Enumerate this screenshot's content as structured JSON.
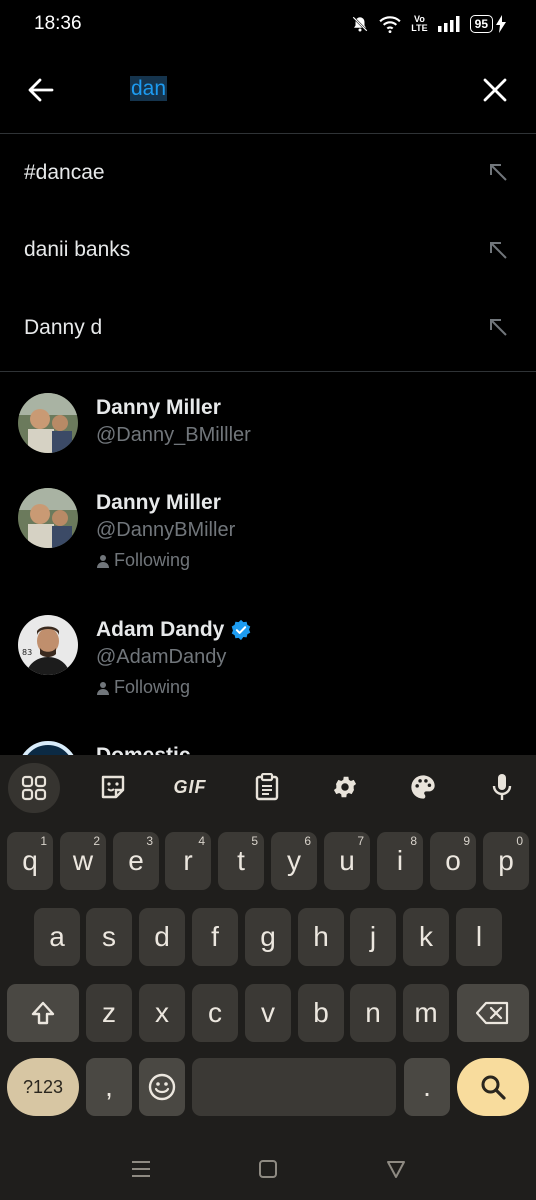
{
  "status": {
    "time": "18:36",
    "network": "Vo\nLTE",
    "battery": "95"
  },
  "search": {
    "query": "dan"
  },
  "suggestions": [
    {
      "prefix": "#dan",
      "rest": "cae"
    },
    {
      "prefix": "dan",
      "rest": "ii banks"
    },
    {
      "prefix": "Dan",
      "rest": "ny d"
    }
  ],
  "users": [
    {
      "name": "Danny Miller",
      "handle": "@Danny_BMilller",
      "following": "",
      "verified": false
    },
    {
      "name": "Danny Miller",
      "handle": "@DannyBMiller",
      "following": "Following",
      "verified": false
    },
    {
      "name": "Adam Dandy",
      "handle": "@AdamDandy",
      "following": "Following",
      "verified": true
    },
    {
      "name": "Domestic",
      "handle": "",
      "following": "",
      "verified": false
    }
  ],
  "keyboard": {
    "toolbar": {
      "gif": "GIF"
    },
    "row1": [
      {
        "key": "q",
        "hint": "1"
      },
      {
        "key": "w",
        "hint": "2"
      },
      {
        "key": "e",
        "hint": "3"
      },
      {
        "key": "r",
        "hint": "4"
      },
      {
        "key": "t",
        "hint": "5"
      },
      {
        "key": "y",
        "hint": "6"
      },
      {
        "key": "u",
        "hint": "7"
      },
      {
        "key": "i",
        "hint": "8"
      },
      {
        "key": "o",
        "hint": "9"
      },
      {
        "key": "p",
        "hint": "0"
      }
    ],
    "row2": [
      "a",
      "s",
      "d",
      "f",
      "g",
      "h",
      "j",
      "k",
      "l"
    ],
    "row3": [
      "z",
      "x",
      "c",
      "v",
      "b",
      "n",
      "m"
    ],
    "symbols": "?123",
    "comma": ",",
    "period": "."
  },
  "colors": {
    "accent": "#1d9bf0",
    "background": "#000000",
    "keyboard_bg": "#1f1e1c",
    "key_bg": "#3b3935",
    "search_key_bg": "#f8dc9d",
    "symbol_key_bg": "#d7c6a3"
  }
}
